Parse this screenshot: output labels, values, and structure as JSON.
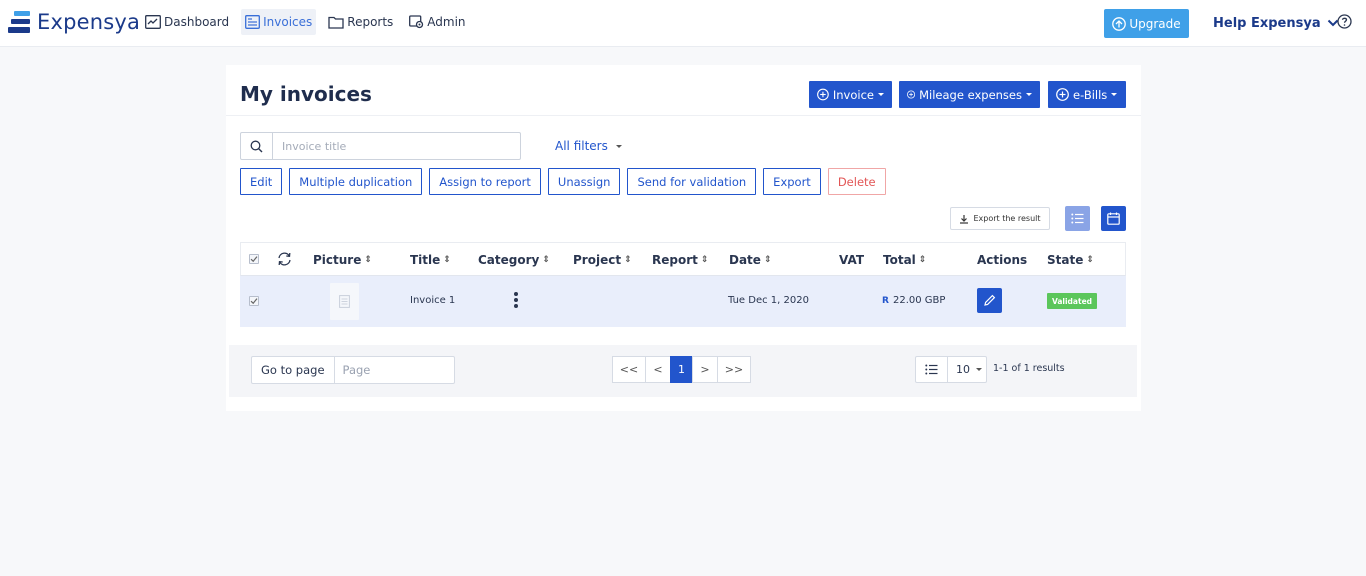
{
  "app": {
    "name": "Expensya"
  },
  "nav": {
    "items": [
      {
        "label": "Dashboard",
        "icon": "dashboard-icon"
      },
      {
        "label": "Invoices",
        "icon": "invoice-icon",
        "active": true
      },
      {
        "label": "Reports",
        "icon": "folder-icon"
      },
      {
        "label": "Admin",
        "icon": "admin-gear-icon"
      }
    ],
    "upgrade_label": "Upgrade",
    "help_label": "Help Expensya"
  },
  "page": {
    "title": "My invoices",
    "create_buttons": [
      "Invoice",
      "Mileage expenses",
      "e-Bills"
    ],
    "search_placeholder": "Invoice title",
    "all_filters_label": "All filters",
    "actions": [
      "Edit",
      "Multiple duplication",
      "Assign to report",
      "Unassign",
      "Send for validation",
      "Export",
      "Delete"
    ],
    "export_result_label": "Export the result"
  },
  "table": {
    "columns": [
      "Picture",
      "Title",
      "Category",
      "Project",
      "Report",
      "Date",
      "VAT",
      "Total",
      "Actions",
      "State"
    ],
    "rows": [
      {
        "title": "Invoice 1",
        "date": "Tue Dec 1, 2020",
        "total_prefix": "R",
        "total": "22.00 GBP",
        "state": "Validated"
      }
    ]
  },
  "pagination": {
    "goto_label": "Go to page",
    "page_placeholder": "Page",
    "first": "<<",
    "prev": "<",
    "current": "1",
    "next": ">",
    "last": ">>",
    "per_page": "10",
    "results": "1-1 of 1 results"
  },
  "colors": {
    "primary": "#2255cc",
    "upgrade": "#3fa0e8",
    "danger": "#e25555",
    "success": "#5bc65b",
    "row_highlight": "#e9eefb"
  }
}
